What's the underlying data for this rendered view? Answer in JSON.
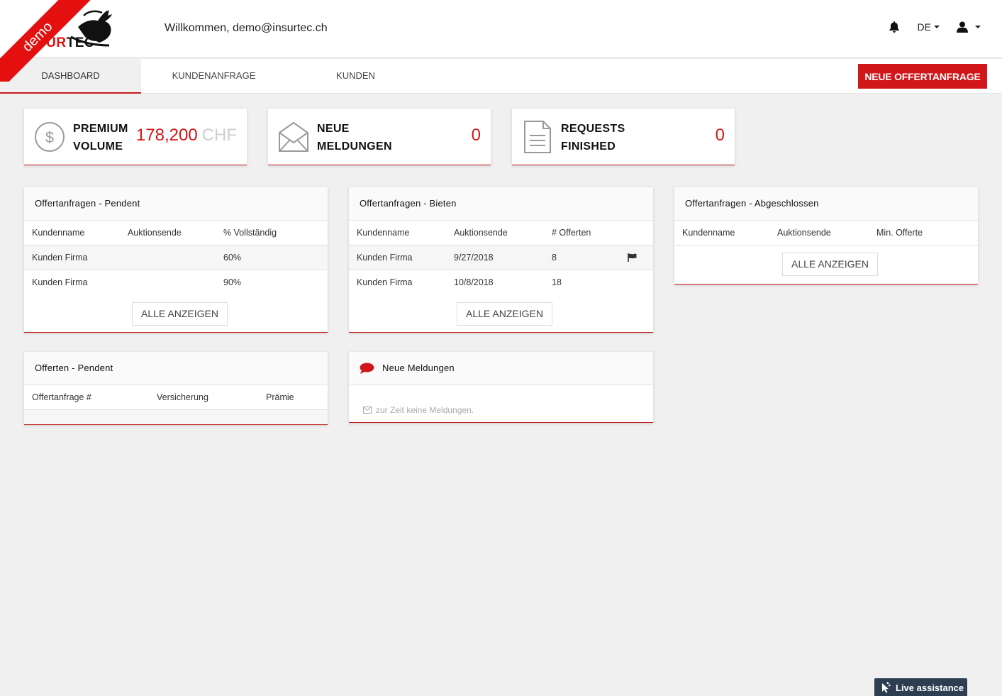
{
  "brand": {
    "ribbon": "demo",
    "logo_part1": "SUR",
    "logo_part2": "TEC",
    "accent": "#d0161a"
  },
  "header": {
    "welcome": "Willkommen, demo@insurtec.ch",
    "lang": "DE"
  },
  "nav": {
    "tabs": [
      {
        "label": "DASHBOARD",
        "active": true
      },
      {
        "label": "KUNDENANFRAGE",
        "active": false
      },
      {
        "label": "KUNDEN",
        "active": false
      }
    ],
    "new_button": "NEUE OFFERTANFRAGE"
  },
  "stats": [
    {
      "line1": "PREMIUM",
      "line2": "VOLUME",
      "value": "178,200",
      "unit": "CHF",
      "icon": "dollar-icon"
    },
    {
      "line1": "NEUE",
      "line2": "MELDUNGEN",
      "value": "0",
      "icon": "envelope-icon"
    },
    {
      "line1": "REQUESTS",
      "line2": "FINISHED",
      "value": "0",
      "icon": "document-icon"
    }
  ],
  "panels": {
    "pendent": {
      "title": "Offertanfragen - Pendent",
      "columns": [
        "Kundenname",
        "Auktionsende",
        "% Vollständig"
      ],
      "rows": [
        [
          "Kunden Firma",
          "",
          "60%"
        ],
        [
          "Kunden Firma",
          "",
          "90%"
        ]
      ],
      "button": "ALLE ANZEIGEN"
    },
    "bieten": {
      "title": "Offertanfragen - Bieten",
      "columns": [
        "Kundenname",
        "Auktionsende",
        "# Offerten"
      ],
      "rows": [
        [
          "Kunden Firma",
          "9/27/2018",
          "8"
        ],
        [
          "Kunden Firma",
          "10/8/2018",
          "18"
        ]
      ],
      "button": "ALLE ANZEIGEN"
    },
    "abgeschlossen": {
      "title": "Offertanfragen - Abgeschlossen",
      "columns": [
        "Kundenname",
        "Auktionsende",
        "Min. Offerte"
      ],
      "button": "ALLE ANZEIGEN"
    },
    "offerten": {
      "title": "Offerten - Pendent",
      "columns": [
        "Offertanfrage #",
        "Versicherung",
        "Prämie"
      ]
    },
    "meldungen": {
      "title": "Neue Meldungen",
      "empty": "zur Zeit keine Meldungen."
    }
  },
  "live": "Live assistance"
}
